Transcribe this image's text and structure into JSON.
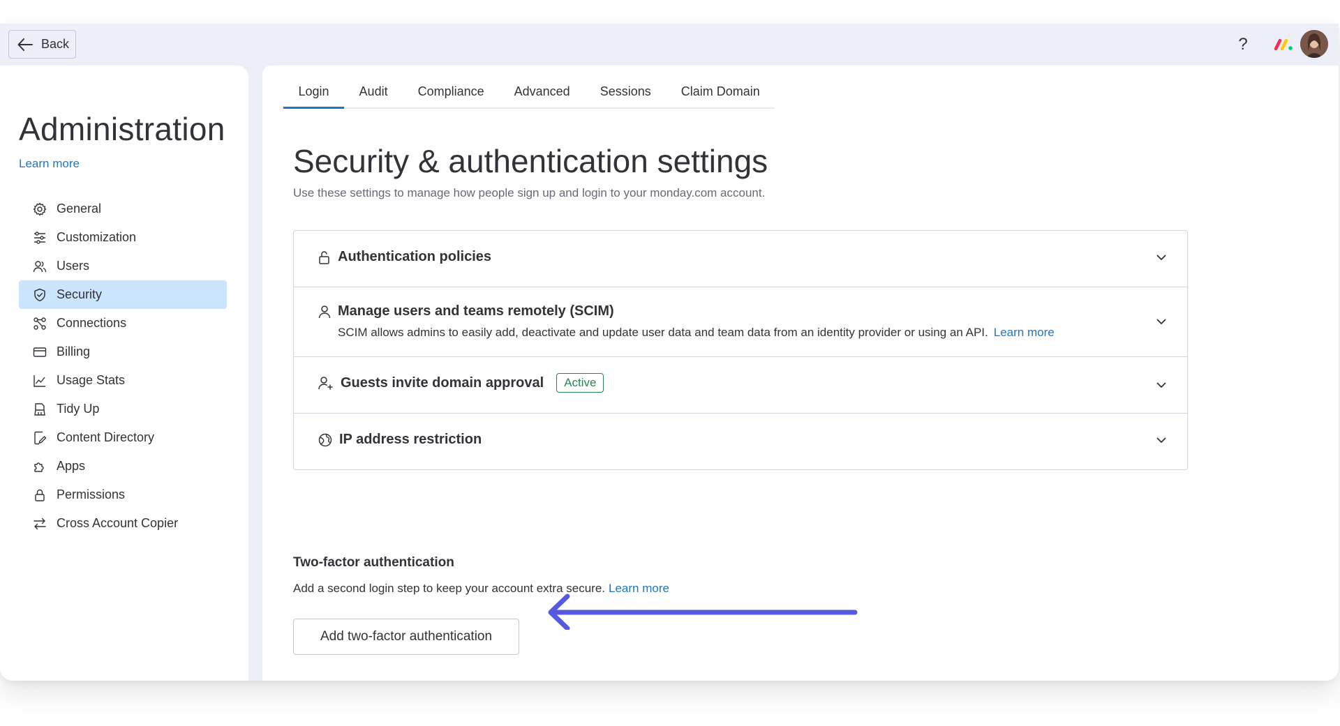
{
  "topbar": {
    "back_label": "Back",
    "help_label": "?"
  },
  "sidebar": {
    "title": "Administration",
    "learn_more": "Learn more",
    "items": [
      {
        "label": "General",
        "icon": "gear-icon"
      },
      {
        "label": "Customization",
        "icon": "sliders-icon"
      },
      {
        "label": "Users",
        "icon": "users-icon"
      },
      {
        "label": "Security",
        "icon": "shield-icon",
        "active": true
      },
      {
        "label": "Connections",
        "icon": "connections-icon"
      },
      {
        "label": "Billing",
        "icon": "credit-card-icon"
      },
      {
        "label": "Usage Stats",
        "icon": "line-chart-icon"
      },
      {
        "label": "Tidy Up",
        "icon": "broom-icon"
      },
      {
        "label": "Content Directory",
        "icon": "document-edit-icon"
      },
      {
        "label": "Apps",
        "icon": "puzzle-icon"
      },
      {
        "label": "Permissions",
        "icon": "lock-icon"
      },
      {
        "label": "Cross Account Copier",
        "icon": "swap-arrows-icon"
      }
    ]
  },
  "tabs": [
    {
      "label": "Login",
      "active": true
    },
    {
      "label": "Audit"
    },
    {
      "label": "Compliance"
    },
    {
      "label": "Advanced"
    },
    {
      "label": "Sessions"
    },
    {
      "label": "Claim Domain"
    }
  ],
  "main": {
    "title": "Security & authentication settings",
    "subtitle": "Use these settings to manage how people sign up and login to your monday.com account."
  },
  "accordion": [
    {
      "title": "Authentication policies",
      "icon": "unlock-icon"
    },
    {
      "title": "Manage users and teams remotely (SCIM)",
      "icon": "user-icon",
      "description": "SCIM allows admins to easily add, deactivate and update user data and team data from an identity provider or using an API.",
      "link": "Learn more"
    },
    {
      "title": "Guests invite domain approval",
      "icon": "user-plus-icon",
      "badge": "Active"
    },
    {
      "title": "IP address restriction",
      "icon": "globe-icon"
    }
  ],
  "two_factor": {
    "title": "Two-factor authentication",
    "description": "Add a second login step to keep your account extra secure.",
    "link": "Learn more",
    "button_label": "Add two-factor authentication"
  },
  "colors": {
    "accent": "#1f76c2",
    "active_nav_bg": "#cce5ff",
    "badge_green": "#258750",
    "arrow": "#5559df"
  }
}
